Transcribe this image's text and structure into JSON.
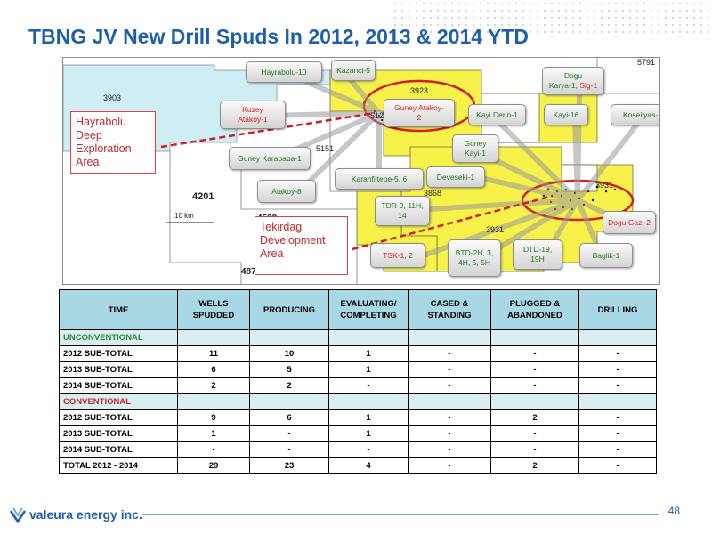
{
  "slide": {
    "title": "TBNG JV New Drill Spuds In 2012, 2013 & 2014 YTD",
    "page_number": "48"
  },
  "logo": {
    "text": "valeura energy inc."
  },
  "map": {
    "labels": [
      "3903",
      "5151",
      "4201",
      "4532",
      "487",
      "3923",
      "3868",
      "3931",
      "3931",
      "5122",
      "5791",
      "10 km"
    ],
    "callouts": [
      {
        "name": "hayrabolu-10",
        "text": "Hayrabolu-10"
      },
      {
        "name": "kazanci-5",
        "text": "Kazanci-5"
      },
      {
        "name": "dogu-karya",
        "text": "Dogu Karya-1, Sig-1"
      },
      {
        "name": "kuzey-atakoy",
        "text": "Kuzey Atakoy-1"
      },
      {
        "name": "guney-atakoy",
        "text": "Guney Atakoy-2"
      },
      {
        "name": "kayi-derin",
        "text": "Kayi Derin-1"
      },
      {
        "name": "kayi-16",
        "text": "Kayi-16"
      },
      {
        "name": "koseilyas",
        "text": "Koseilyas-1"
      },
      {
        "name": "guney-kayi",
        "text": "Guney Kayi-1"
      },
      {
        "name": "guney-karababa",
        "text": "Guney Karababa-1"
      },
      {
        "name": "karanfiltepe",
        "text": "Karanfiltepe-5, 6"
      },
      {
        "name": "deveseki",
        "text": "Deveseki-1"
      },
      {
        "name": "atakoy-8",
        "text": "Atakoy-8"
      },
      {
        "name": "tdr",
        "text": "TDR-9, 11H, 14"
      },
      {
        "name": "dogu-gazi",
        "text": "Dogu Gazi-2"
      },
      {
        "name": "tsk",
        "text": "TSK-1, 2"
      },
      {
        "name": "btd",
        "text": "BTD-2H, 3, 4H, 5, 5H"
      },
      {
        "name": "dtd",
        "text": "DTD-19, 19H"
      },
      {
        "name": "baglik",
        "text": "Baglik-1"
      }
    ],
    "hayrabolu_area": "Hayrabolu Deep Exploration Area",
    "tekirdag_area": "Tekirdag Development Area"
  },
  "table": {
    "headers": [
      "TIME",
      "WELLS SPUDDED",
      "PRODUCING",
      "EVALUATING/ COMPLETING",
      "CASED & STANDING",
      "PLUGGED & ABANDONED",
      "DRILLING"
    ],
    "section_unconventional": "UNCONVENTIONAL",
    "section_conventional": "CONVENTIONAL",
    "unconventional_rows": [
      [
        "2012 SUB-TOTAL",
        "11",
        "10",
        "1",
        "-",
        "-",
        "-"
      ],
      [
        "2013 SUB-TOTAL",
        "6",
        "5",
        "1",
        "-",
        "-",
        "-"
      ],
      [
        "2014 SUB-TOTAL",
        "2",
        "2",
        "-",
        "-",
        "-",
        "-"
      ]
    ],
    "conventional_rows": [
      [
        "2012 SUB-TOTAL",
        "9",
        "6",
        "1",
        "-",
        "2",
        "-"
      ],
      [
        "2013 SUB-TOTAL",
        "1",
        "-",
        "1",
        "-",
        "-",
        "-"
      ],
      [
        "2014 SUB-TOTAL",
        "-",
        "-",
        "-",
        "-",
        "-",
        "-"
      ]
    ],
    "total_row": [
      "TOTAL 2012 - 2014",
      "29",
      "23",
      "4",
      "-",
      "2",
      "-"
    ]
  }
}
